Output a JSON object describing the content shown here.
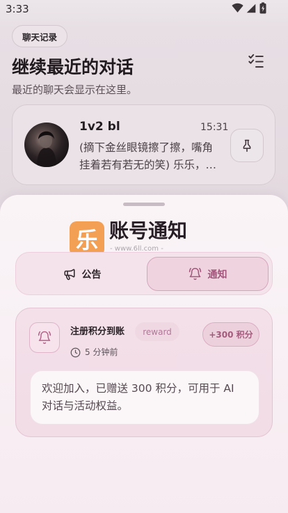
{
  "status_bar": {
    "time": "3:33",
    "icons": [
      "wifi-icon",
      "signal-icon",
      "battery-charging-icon"
    ]
  },
  "background": {
    "chip_label": "聊天记录",
    "title": "继续最近的对话",
    "subtitle": "最近的聊天会显示在这里。",
    "header_action_icon": "checklist-icon",
    "conversations": [
      {
        "name": "1v2 bl",
        "time": "15:31",
        "preview_lines": [
          "(摘下金丝眼镜擦了擦，嘴角",
          "挂着若有若无的笑) 乐乐，…"
        ],
        "action_icon": "pin-icon"
      }
    ]
  },
  "sheet": {
    "title": "账号通知",
    "tabs": [
      {
        "label": "公告",
        "icon": "megaphone-icon",
        "selected": false
      },
      {
        "label": "通知",
        "icon": "bell-ring-icon",
        "selected": true
      }
    ],
    "notifications": [
      {
        "icon": "bell-ring-icon",
        "title": "注册积分到账",
        "tag": "reward",
        "points": "+300 积分",
        "time": "5 分钟前",
        "message_lines": [
          "欢迎加入，已赠送 300 积分，可用于 AI",
          "对话与活动权益。"
        ]
      }
    ]
  },
  "watermark": {
    "logo_char": "乐",
    "site": "- www.6ll.com -"
  },
  "colors": {
    "accent": "#a3567b",
    "selected_tab_bg": "#efd4e0",
    "sheet_bg": "#f8f0f4",
    "card_bg": "#f2dde7",
    "text_primary": "#261e24",
    "watermark_orange": "#f28c30"
  }
}
